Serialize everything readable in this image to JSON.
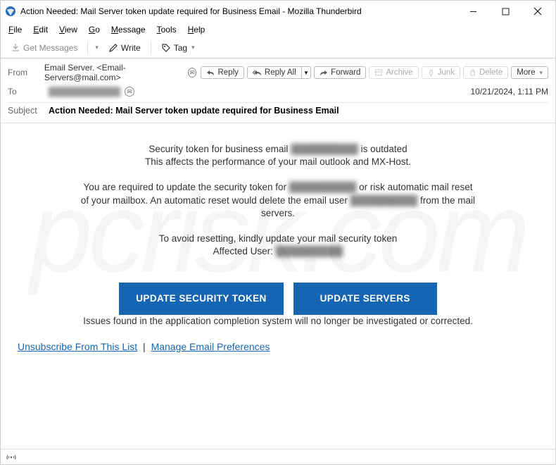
{
  "window": {
    "title": "Action Needed: Mail Server token update required for Business Email - Mozilla Thunderbird"
  },
  "menu": {
    "file": "File",
    "edit": "Edit",
    "view": "View",
    "go": "Go",
    "message": "Message",
    "tools": "Tools",
    "help": "Help"
  },
  "toolbar": {
    "get_messages": "Get Messages",
    "write": "Write",
    "tag": "Tag"
  },
  "header": {
    "from_label": "From",
    "from_value": "Email Server. <Email-Servers@mail.com>",
    "to_label": "To",
    "to_value_blurred": "████████████",
    "subject_label": "Subject",
    "subject_value": "Action Needed: Mail Server token update required for Business Email",
    "date": "10/21/2024, 1:11 PM"
  },
  "actions": {
    "reply": "Reply",
    "reply_all": "Reply All",
    "forward": "Forward",
    "archive": "Archive",
    "junk": "Junk",
    "delete": "Delete",
    "more": "More"
  },
  "body": {
    "line1a": "Security token for business email ",
    "line1_blur": "██████████",
    "line1b": " is outdated",
    "line2": "This affects the performance of your mail outlook and MX-Host.",
    "line3a": "You are required to update the security token for ",
    "line3_blur": "██████████",
    "line3b": " or risk automatic mail reset",
    "line4a": "of your mailbox. An automatic reset would delete the email user ",
    "line4_blur": "██████████",
    "line4b": " from the mail",
    "line5": "servers.",
    "line6": "To avoid resetting, kindly update your mail security token",
    "line7a": "Affected User: ",
    "line7_blur": "██████████",
    "btn_update_token": "UPDATE SECURITY TOKEN",
    "btn_update_servers": "UPDATE SERVERS",
    "footer": "Issues found in the application completion system will no longer be investigated or corrected.",
    "unsubscribe": "Unsubscribe From This List",
    "manage_prefs": "Manage Email Preferences"
  },
  "status": {
    "indicator": "((○))"
  }
}
